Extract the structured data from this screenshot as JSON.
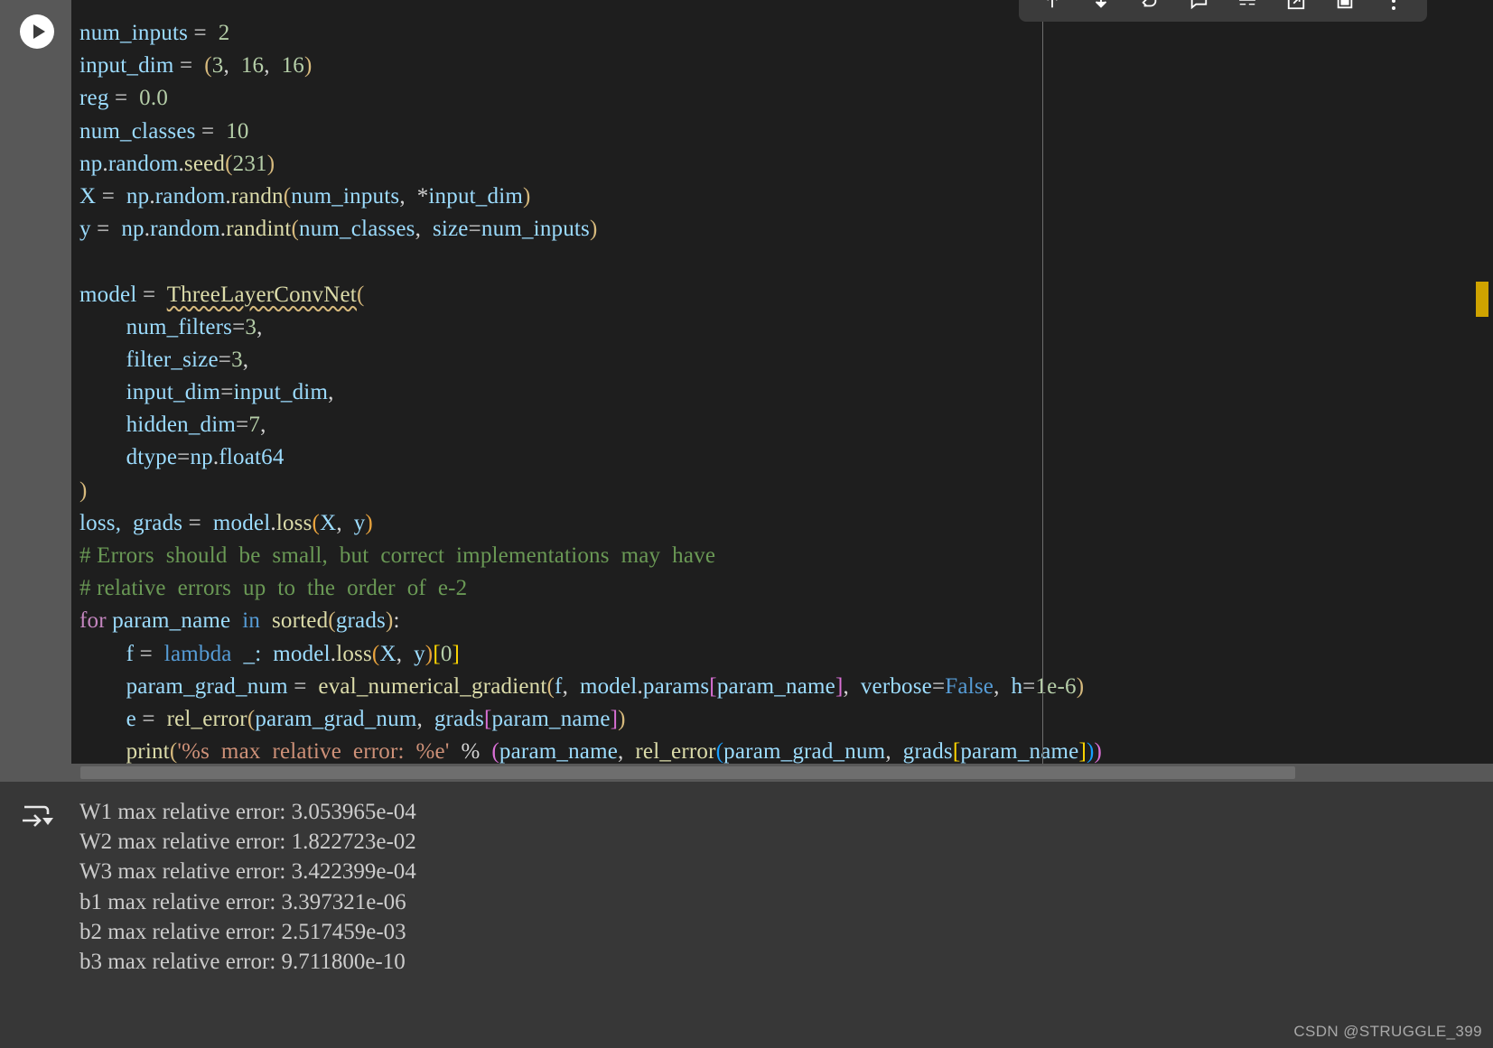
{
  "toolbar": {
    "buttons": [
      {
        "name": "move-up-icon",
        "title": "Move Cell Up"
      },
      {
        "name": "move-down-icon",
        "title": "Move Cell Down"
      },
      {
        "name": "run-above-icon",
        "title": "Execute Above Cells"
      },
      {
        "name": "comment-icon",
        "title": "Add Comment"
      },
      {
        "name": "split-cell-icon",
        "title": "Split Cell"
      },
      {
        "name": "export-icon",
        "title": "Export / Open in Editor"
      },
      {
        "name": "delete-cell-icon",
        "title": "Delete Cell"
      },
      {
        "name": "more-actions-icon",
        "title": "More Actions..."
      }
    ]
  },
  "gutter": {
    "run_cell_label": "Execute Cell",
    "output_label": "Cell Output"
  },
  "editor": {
    "code": [
      [
        {
          "t": "num_inputs ",
          "c": "t-var"
        },
        {
          "t": "= ",
          "c": "t-plain"
        },
        {
          "t": " 2",
          "c": "t-num"
        }
      ],
      [
        {
          "t": "input_dim ",
          "c": "t-var"
        },
        {
          "t": "= ",
          "c": "t-plain"
        },
        {
          "t": " ",
          "c": "t-plain"
        },
        {
          "t": "(",
          "c": "p-yellow"
        },
        {
          "t": "3",
          "c": "t-num"
        },
        {
          "t": ",  ",
          "c": "t-plain"
        },
        {
          "t": "16",
          "c": "t-num"
        },
        {
          "t": ",  ",
          "c": "t-plain"
        },
        {
          "t": "16",
          "c": "t-num"
        },
        {
          "t": ")",
          "c": "p-yellow"
        }
      ],
      [
        {
          "t": "reg ",
          "c": "t-var"
        },
        {
          "t": "= ",
          "c": "t-plain"
        },
        {
          "t": " 0.0",
          "c": "t-num"
        }
      ],
      [
        {
          "t": "num_classes ",
          "c": "t-var"
        },
        {
          "t": "= ",
          "c": "t-plain"
        },
        {
          "t": " 10",
          "c": "t-num"
        }
      ],
      [
        {
          "t": "np",
          "c": "t-var"
        },
        {
          "t": ".",
          "c": "t-plain"
        },
        {
          "t": "random",
          "c": "t-var"
        },
        {
          "t": ".",
          "c": "t-plain"
        },
        {
          "t": "seed",
          "c": "t-fn"
        },
        {
          "t": "(",
          "c": "p-yellow"
        },
        {
          "t": "231",
          "c": "t-num"
        },
        {
          "t": ")",
          "c": "p-yellow"
        }
      ],
      [
        {
          "t": "X ",
          "c": "t-var"
        },
        {
          "t": "= ",
          "c": "t-plain"
        },
        {
          "t": " np",
          "c": "t-var"
        },
        {
          "t": ".",
          "c": "t-plain"
        },
        {
          "t": "random",
          "c": "t-var"
        },
        {
          "t": ".",
          "c": "t-plain"
        },
        {
          "t": "randn",
          "c": "t-fn"
        },
        {
          "t": "(",
          "c": "p-yellow"
        },
        {
          "t": "num_inputs",
          "c": "t-var"
        },
        {
          "t": ",  *",
          "c": "t-plain"
        },
        {
          "t": "input_dim",
          "c": "t-var"
        },
        {
          "t": ")",
          "c": "p-yellow"
        }
      ],
      [
        {
          "t": "y ",
          "c": "t-var"
        },
        {
          "t": "= ",
          "c": "t-plain"
        },
        {
          "t": " np",
          "c": "t-var"
        },
        {
          "t": ".",
          "c": "t-plain"
        },
        {
          "t": "random",
          "c": "t-var"
        },
        {
          "t": ".",
          "c": "t-plain"
        },
        {
          "t": "randint",
          "c": "t-fn"
        },
        {
          "t": "(",
          "c": "p-yellow"
        },
        {
          "t": "num_classes",
          "c": "t-var"
        },
        {
          "t": ",  ",
          "c": "t-plain"
        },
        {
          "t": "size",
          "c": "t-var"
        },
        {
          "t": "=",
          "c": "t-plain"
        },
        {
          "t": "num_inputs",
          "c": "t-var"
        },
        {
          "t": ")",
          "c": "p-yellow"
        }
      ],
      [],
      [
        {
          "t": "model ",
          "c": "t-var"
        },
        {
          "t": "= ",
          "c": "t-plain"
        },
        {
          "t": " ",
          "c": "t-plain"
        },
        {
          "t": "ThreeLayerConvNet",
          "c": "t-fn squiggle"
        },
        {
          "t": "(",
          "c": "p-yellow"
        }
      ],
      [
        {
          "t": "        ",
          "c": "t-plain"
        },
        {
          "t": "num_filters",
          "c": "t-var"
        },
        {
          "t": "=",
          "c": "t-plain"
        },
        {
          "t": "3",
          "c": "t-num"
        },
        {
          "t": ",",
          "c": "t-plain"
        }
      ],
      [
        {
          "t": "        ",
          "c": "t-plain"
        },
        {
          "t": "filter_size",
          "c": "t-var"
        },
        {
          "t": "=",
          "c": "t-plain"
        },
        {
          "t": "3",
          "c": "t-num"
        },
        {
          "t": ",",
          "c": "t-plain"
        }
      ],
      [
        {
          "t": "        ",
          "c": "t-plain"
        },
        {
          "t": "input_dim",
          "c": "t-var"
        },
        {
          "t": "=",
          "c": "t-plain"
        },
        {
          "t": "input_dim",
          "c": "t-var"
        },
        {
          "t": ",",
          "c": "t-plain"
        }
      ],
      [
        {
          "t": "        ",
          "c": "t-plain"
        },
        {
          "t": "hidden_dim",
          "c": "t-var"
        },
        {
          "t": "=",
          "c": "t-plain"
        },
        {
          "t": "7",
          "c": "t-num"
        },
        {
          "t": ",",
          "c": "t-plain"
        }
      ],
      [
        {
          "t": "        ",
          "c": "t-plain"
        },
        {
          "t": "dtype",
          "c": "t-var"
        },
        {
          "t": "=",
          "c": "t-plain"
        },
        {
          "t": "np",
          "c": "t-var"
        },
        {
          "t": ".",
          "c": "t-plain"
        },
        {
          "t": "float64",
          "c": "t-var"
        }
      ],
      [
        {
          "t": ")",
          "c": "p-yellow"
        }
      ],
      [
        {
          "t": "loss, ",
          "c": "t-var"
        },
        {
          "t": " grads ",
          "c": "t-var"
        },
        {
          "t": "= ",
          "c": "t-plain"
        },
        {
          "t": " model",
          "c": "t-var"
        },
        {
          "t": ".",
          "c": "t-plain"
        },
        {
          "t": "loss",
          "c": "t-fn"
        },
        {
          "t": "(",
          "c": "p-orange"
        },
        {
          "t": "X",
          "c": "t-var"
        },
        {
          "t": ",  ",
          "c": "t-plain"
        },
        {
          "t": "y",
          "c": "t-var"
        },
        {
          "t": ")",
          "c": "p-orange"
        }
      ],
      [
        {
          "t": "# Errors  should  be  small,  but  correct  implementations  may  have",
          "c": "t-cmt"
        }
      ],
      [
        {
          "t": "# relative  errors  up  to  the  order  of  e-2",
          "c": "t-cmt"
        }
      ],
      [
        {
          "t": "for",
          "c": "t-kw"
        },
        {
          "t": " param_name ",
          "c": "t-var"
        },
        {
          "t": " in",
          "c": "t-kw2"
        },
        {
          "t": "  ",
          "c": "t-plain"
        },
        {
          "t": "sorted",
          "c": "t-fn"
        },
        {
          "t": "(",
          "c": "p-yellow"
        },
        {
          "t": "grads",
          "c": "t-var"
        },
        {
          "t": ")",
          "c": "p-yellow"
        },
        {
          "t": ":",
          "c": "t-plain"
        }
      ],
      [
        {
          "t": "        ",
          "c": "t-plain"
        },
        {
          "t": "f ",
          "c": "t-var"
        },
        {
          "t": "= ",
          "c": "t-plain"
        },
        {
          "t": " ",
          "c": "t-plain"
        },
        {
          "t": "lambda",
          "c": "t-kw2"
        },
        {
          "t": "  _:  ",
          "c": "t-var"
        },
        {
          "t": "model",
          "c": "t-var"
        },
        {
          "t": ".",
          "c": "t-plain"
        },
        {
          "t": "loss",
          "c": "t-fn"
        },
        {
          "t": "(",
          "c": "p-orange"
        },
        {
          "t": "X",
          "c": "t-var"
        },
        {
          "t": ",  ",
          "c": "t-plain"
        },
        {
          "t": "y",
          "c": "t-var"
        },
        {
          "t": ")",
          "c": "p-orange"
        },
        {
          "t": "[",
          "c": "p-gold"
        },
        {
          "t": "0",
          "c": "t-num"
        },
        {
          "t": "]",
          "c": "p-gold"
        }
      ],
      [
        {
          "t": "        ",
          "c": "t-plain"
        },
        {
          "t": "param_grad_num ",
          "c": "t-var"
        },
        {
          "t": "= ",
          "c": "t-plain"
        },
        {
          "t": " ",
          "c": "t-plain"
        },
        {
          "t": "eval_numerical_gradient",
          "c": "t-fn"
        },
        {
          "t": "(",
          "c": "p-yellow"
        },
        {
          "t": "f",
          "c": "t-var"
        },
        {
          "t": ",  ",
          "c": "t-plain"
        },
        {
          "t": "model",
          "c": "t-var"
        },
        {
          "t": ".",
          "c": "t-plain"
        },
        {
          "t": "params",
          "c": "t-var"
        },
        {
          "t": "[",
          "c": "p-pink"
        },
        {
          "t": "param_name",
          "c": "t-var"
        },
        {
          "t": "]",
          "c": "p-pink"
        },
        {
          "t": ",  ",
          "c": "t-plain"
        },
        {
          "t": "verbose",
          "c": "t-var"
        },
        {
          "t": "=",
          "c": "t-plain"
        },
        {
          "t": "False",
          "c": "t-kw2"
        },
        {
          "t": ",  ",
          "c": "t-plain"
        },
        {
          "t": "h",
          "c": "t-var"
        },
        {
          "t": "=",
          "c": "t-plain"
        },
        {
          "t": "1e-6",
          "c": "t-num"
        },
        {
          "t": ")",
          "c": "p-yellow"
        }
      ],
      [
        {
          "t": "        ",
          "c": "t-plain"
        },
        {
          "t": "e ",
          "c": "t-var"
        },
        {
          "t": "= ",
          "c": "t-plain"
        },
        {
          "t": " ",
          "c": "t-plain"
        },
        {
          "t": "rel_error",
          "c": "t-fn"
        },
        {
          "t": "(",
          "c": "p-yellow"
        },
        {
          "t": "param_grad_num",
          "c": "t-var"
        },
        {
          "t": ",  ",
          "c": "t-plain"
        },
        {
          "t": "grads",
          "c": "t-var"
        },
        {
          "t": "[",
          "c": "p-pink"
        },
        {
          "t": "param_name",
          "c": "t-var"
        },
        {
          "t": "]",
          "c": "p-pink"
        },
        {
          "t": ")",
          "c": "p-yellow"
        }
      ],
      [
        {
          "t": "        ",
          "c": "t-plain"
        },
        {
          "t": "print",
          "c": "t-fn"
        },
        {
          "t": "(",
          "c": "p-yellow"
        },
        {
          "t": "'%s  max  relative  error:  %e'",
          "c": "t-str"
        },
        {
          "t": "  %  ",
          "c": "t-plain"
        },
        {
          "t": "(",
          "c": "p-pink"
        },
        {
          "t": "param_name",
          "c": "t-var"
        },
        {
          "t": ",  ",
          "c": "t-plain"
        },
        {
          "t": "rel_error",
          "c": "t-fn"
        },
        {
          "t": "(",
          "c": "p-blue"
        },
        {
          "t": "param_grad_num",
          "c": "t-var"
        },
        {
          "t": ",  ",
          "c": "t-plain"
        },
        {
          "t": "grads",
          "c": "t-var"
        },
        {
          "t": "[",
          "c": "p-gold"
        },
        {
          "t": "param_name",
          "c": "t-var"
        },
        {
          "t": "]",
          "c": "p-gold"
        },
        {
          "t": ")",
          "c": "p-blue"
        },
        {
          "t": ")",
          "c": "p-pink"
        }
      ]
    ]
  },
  "output": {
    "lines": [
      "W1 max relative error: 3.053965e-04",
      "W2 max relative error: 1.822723e-02",
      "W3 max relative error: 3.422399e-04",
      "b1 max relative error: 3.397321e-06",
      "b2 max relative error: 2.517459e-03",
      "b3 max relative error: 9.711800e-10"
    ]
  },
  "watermark": {
    "text": "CSDN @STRUGGLE_399"
  },
  "colors": {
    "editor_bg": "#1e1e1e",
    "gutter_bg": "#585858",
    "output_bg": "#373737",
    "toolbar_bg": "#3b3b3b",
    "warning_marker": "#cfa300"
  }
}
